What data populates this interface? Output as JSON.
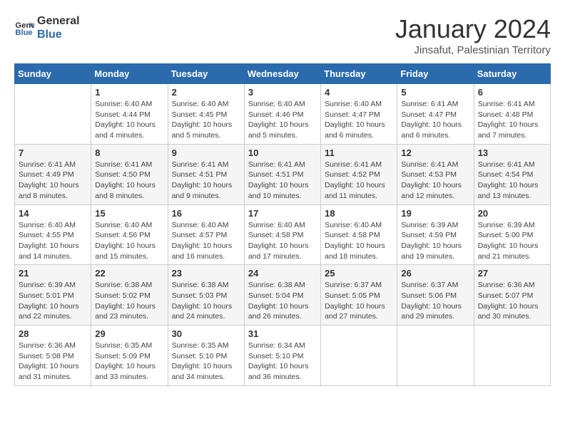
{
  "logo": {
    "text_general": "General",
    "text_blue": "Blue"
  },
  "title": "January 2024",
  "subtitle": "Jinsafut, Palestinian Territory",
  "headers": [
    "Sunday",
    "Monday",
    "Tuesday",
    "Wednesday",
    "Thursday",
    "Friday",
    "Saturday"
  ],
  "weeks": [
    [
      {
        "day": "",
        "info": ""
      },
      {
        "day": "1",
        "info": "Sunrise: 6:40 AM\nSunset: 4:44 PM\nDaylight: 10 hours\nand 4 minutes."
      },
      {
        "day": "2",
        "info": "Sunrise: 6:40 AM\nSunset: 4:45 PM\nDaylight: 10 hours\nand 5 minutes."
      },
      {
        "day": "3",
        "info": "Sunrise: 6:40 AM\nSunset: 4:46 PM\nDaylight: 10 hours\nand 5 minutes."
      },
      {
        "day": "4",
        "info": "Sunrise: 6:40 AM\nSunset: 4:47 PM\nDaylight: 10 hours\nand 6 minutes."
      },
      {
        "day": "5",
        "info": "Sunrise: 6:41 AM\nSunset: 4:47 PM\nDaylight: 10 hours\nand 6 minutes."
      },
      {
        "day": "6",
        "info": "Sunrise: 6:41 AM\nSunset: 4:48 PM\nDaylight: 10 hours\nand 7 minutes."
      }
    ],
    [
      {
        "day": "7",
        "info": "Sunrise: 6:41 AM\nSunset: 4:49 PM\nDaylight: 10 hours\nand 8 minutes."
      },
      {
        "day": "8",
        "info": "Sunrise: 6:41 AM\nSunset: 4:50 PM\nDaylight: 10 hours\nand 8 minutes."
      },
      {
        "day": "9",
        "info": "Sunrise: 6:41 AM\nSunset: 4:51 PM\nDaylight: 10 hours\nand 9 minutes."
      },
      {
        "day": "10",
        "info": "Sunrise: 6:41 AM\nSunset: 4:51 PM\nDaylight: 10 hours\nand 10 minutes."
      },
      {
        "day": "11",
        "info": "Sunrise: 6:41 AM\nSunset: 4:52 PM\nDaylight: 10 hours\nand 11 minutes."
      },
      {
        "day": "12",
        "info": "Sunrise: 6:41 AM\nSunset: 4:53 PM\nDaylight: 10 hours\nand 12 minutes."
      },
      {
        "day": "13",
        "info": "Sunrise: 6:41 AM\nSunset: 4:54 PM\nDaylight: 10 hours\nand 13 minutes."
      }
    ],
    [
      {
        "day": "14",
        "info": "Sunrise: 6:40 AM\nSunset: 4:55 PM\nDaylight: 10 hours\nand 14 minutes."
      },
      {
        "day": "15",
        "info": "Sunrise: 6:40 AM\nSunset: 4:56 PM\nDaylight: 10 hours\nand 15 minutes."
      },
      {
        "day": "16",
        "info": "Sunrise: 6:40 AM\nSunset: 4:57 PM\nDaylight: 10 hours\nand 16 minutes."
      },
      {
        "day": "17",
        "info": "Sunrise: 6:40 AM\nSunset: 4:58 PM\nDaylight: 10 hours\nand 17 minutes."
      },
      {
        "day": "18",
        "info": "Sunrise: 6:40 AM\nSunset: 4:58 PM\nDaylight: 10 hours\nand 18 minutes."
      },
      {
        "day": "19",
        "info": "Sunrise: 6:39 AM\nSunset: 4:59 PM\nDaylight: 10 hours\nand 19 minutes."
      },
      {
        "day": "20",
        "info": "Sunrise: 6:39 AM\nSunset: 5:00 PM\nDaylight: 10 hours\nand 21 minutes."
      }
    ],
    [
      {
        "day": "21",
        "info": "Sunrise: 6:39 AM\nSunset: 5:01 PM\nDaylight: 10 hours\nand 22 minutes."
      },
      {
        "day": "22",
        "info": "Sunrise: 6:38 AM\nSunset: 5:02 PM\nDaylight: 10 hours\nand 23 minutes."
      },
      {
        "day": "23",
        "info": "Sunrise: 6:38 AM\nSunset: 5:03 PM\nDaylight: 10 hours\nand 24 minutes."
      },
      {
        "day": "24",
        "info": "Sunrise: 6:38 AM\nSunset: 5:04 PM\nDaylight: 10 hours\nand 26 minutes."
      },
      {
        "day": "25",
        "info": "Sunrise: 6:37 AM\nSunset: 5:05 PM\nDaylight: 10 hours\nand 27 minutes."
      },
      {
        "day": "26",
        "info": "Sunrise: 6:37 AM\nSunset: 5:06 PM\nDaylight: 10 hours\nand 29 minutes."
      },
      {
        "day": "27",
        "info": "Sunrise: 6:36 AM\nSunset: 5:07 PM\nDaylight: 10 hours\nand 30 minutes."
      }
    ],
    [
      {
        "day": "28",
        "info": "Sunrise: 6:36 AM\nSunset: 5:08 PM\nDaylight: 10 hours\nand 31 minutes."
      },
      {
        "day": "29",
        "info": "Sunrise: 6:35 AM\nSunset: 5:09 PM\nDaylight: 10 hours\nand 33 minutes."
      },
      {
        "day": "30",
        "info": "Sunrise: 6:35 AM\nSunset: 5:10 PM\nDaylight: 10 hours\nand 34 minutes."
      },
      {
        "day": "31",
        "info": "Sunrise: 6:34 AM\nSunset: 5:10 PM\nDaylight: 10 hours\nand 36 minutes."
      },
      {
        "day": "",
        "info": ""
      },
      {
        "day": "",
        "info": ""
      },
      {
        "day": "",
        "info": ""
      }
    ]
  ]
}
